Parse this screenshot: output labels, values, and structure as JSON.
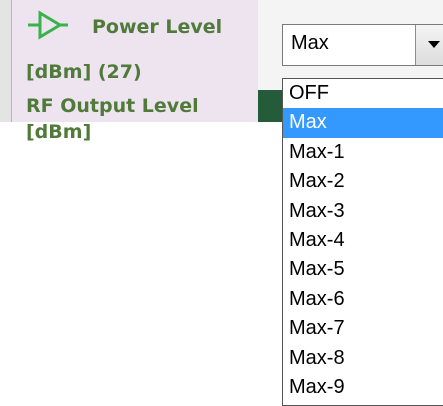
{
  "property_panel": {
    "power_level_line1": "Power Level",
    "power_level_line2": "[dBm] (27)",
    "rf_output_line1": "RF Output Level",
    "rf_output_line2": "[dBm]",
    "expand_icon": "triangle-right-icon"
  },
  "combo": {
    "value": "Max",
    "arrow_icon": "chevron-down-icon"
  },
  "dropdown": {
    "selected_index": 1,
    "options": [
      "OFF",
      "Max",
      "Max-1",
      "Max-2",
      "Max-3",
      "Max-4",
      "Max-5",
      "Max-6",
      "Max-7",
      "Max-8",
      "Max-9"
    ]
  },
  "colors": {
    "label_green": "#4f7a3a",
    "panel_lavender": "#ede4ef",
    "selection_blue": "#3399ff",
    "cell_dark_green": "#245c3a"
  }
}
